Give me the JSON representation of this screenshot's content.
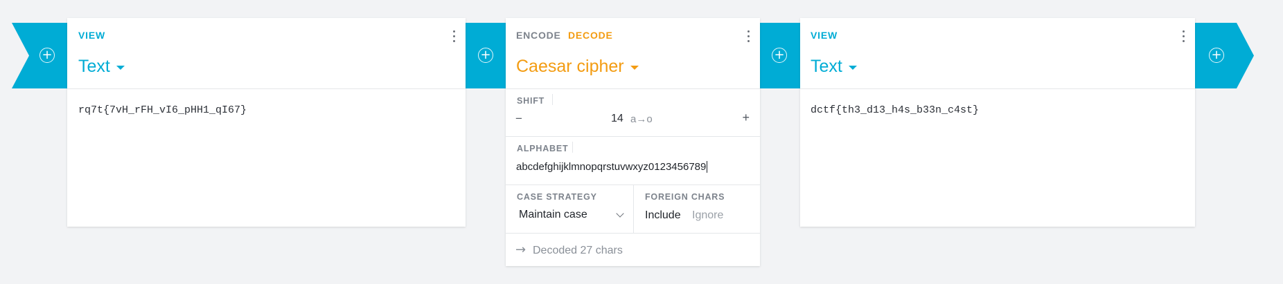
{
  "left_card": {
    "label": "VIEW",
    "format": "Text",
    "content": "rq7t{7vH_rFH_vI6_pHH1_qI67}"
  },
  "operation_card": {
    "tab_encode": "ENCODE",
    "tab_decode": "DECODE",
    "title": "Caesar cipher",
    "shift": {
      "label": "SHIFT",
      "minus": "−",
      "value": "14",
      "mapping": "a→o",
      "plus": "+"
    },
    "alphabet": {
      "label": "ALPHABET",
      "value": "abcdefghijklmnopqrstuvwxyz0123456789"
    },
    "case_strategy": {
      "label": "CASE STRATEGY",
      "value": "Maintain case"
    },
    "foreign_chars": {
      "label": "FOREIGN CHARS",
      "option_include": "Include",
      "option_ignore": "Ignore"
    },
    "status": "Decoded 27 chars"
  },
  "right_card": {
    "label": "VIEW",
    "format": "Text",
    "content": "dctf{th3_d13_h4s_b33n_c4st}"
  },
  "add_icon_glyph": "⊕",
  "colors": {
    "accent_blue": "#00acd5",
    "accent_orange": "#f39c12",
    "background": "#f2f3f5"
  }
}
